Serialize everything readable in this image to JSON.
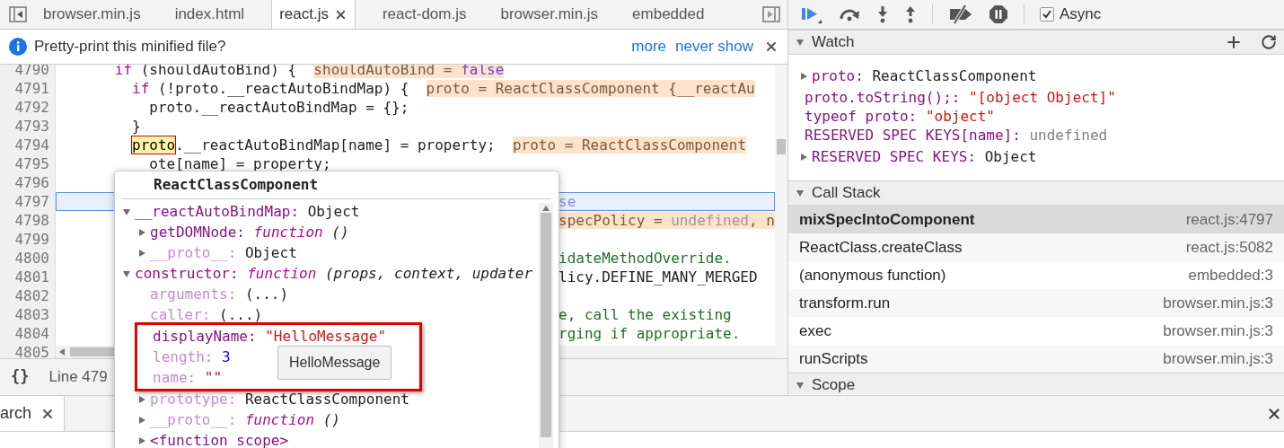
{
  "editor_tabs": [
    {
      "label": "browser.min.js",
      "selected": false,
      "closable": false
    },
    {
      "label": "index.html",
      "selected": false,
      "closable": false
    },
    {
      "label": "react.js",
      "selected": true,
      "closable": true
    },
    {
      "label": "react-dom.js",
      "selected": false,
      "closable": false
    },
    {
      "label": "browser.min.js",
      "selected": false,
      "closable": false
    },
    {
      "label": "embedded",
      "selected": false,
      "closable": false
    }
  ],
  "infobar": {
    "message": "Pretty-print this minified file?",
    "links": [
      "more",
      "never show"
    ]
  },
  "code_lines": [
    {
      "number": "4790",
      "current": false,
      "tokens": [
        {
          "kind": "kw",
          "t": "      if"
        },
        {
          "kind": "plain",
          "t": " (shouldAutoBind) {  "
        },
        {
          "kind": "anno",
          "t": "shouldAutoBind = "
        },
        {
          "kind": "anno-kw",
          "t": "false"
        }
      ]
    },
    {
      "number": "4791",
      "current": false,
      "tokens": [
        {
          "kind": "kw",
          "t": "        if"
        },
        {
          "kind": "plain",
          "t": " (!proto.__reactAutoBindMap) {  "
        },
        {
          "kind": "anno",
          "t": "proto = ReactClassComponent {__reactAu"
        }
      ]
    },
    {
      "number": "4792",
      "current": false,
      "tokens": [
        {
          "kind": "plain",
          "t": "          proto.__reactAutoBindMap = {};"
        }
      ]
    },
    {
      "number": "4793",
      "current": false,
      "tokens": [
        {
          "kind": "plain",
          "t": "        }"
        }
      ]
    },
    {
      "number": "4794",
      "current": false,
      "tokens": [
        {
          "kind": "hl",
          "t": "        proto"
        },
        {
          "kind": "plain",
          "t": ".__reactAutoBindMap[name] = property;  "
        },
        {
          "kind": "anno",
          "t": "proto = ReactClassComponent"
        }
      ]
    },
    {
      "number": "4795",
      "current": false,
      "tokens": [
        {
          "kind": "plain",
          "t": "          ote[name] = property;"
        }
      ]
    },
    {
      "number": "4796",
      "current": false
    },
    {
      "number": "4797",
      "current": true,
      "tail": [
        {
          "kind": "kw-faint",
          "t": "se"
        }
      ]
    },
    {
      "number": "4798",
      "current": false,
      "tail": [
        {
          "kind": "anno",
          "t": "specPolicy = "
        },
        {
          "kind": "anno-dim",
          "t": "undefined"
        },
        {
          "kind": "anno",
          "t": ", n"
        }
      ]
    },
    {
      "number": "4799",
      "current": false
    },
    {
      "number": "4800",
      "current": false,
      "tail": [
        {
          "kind": "comment",
          "t": "idateMethodOverride."
        }
      ]
    },
    {
      "number": "4801",
      "current": false,
      "tail": [
        {
          "kind": "plain",
          "t": "licy.DEFINE_MANY_MERGED"
        }
      ]
    },
    {
      "number": "4802",
      "current": false
    },
    {
      "number": "4803",
      "current": false,
      "tail": [
        {
          "kind": "comment",
          "t": "e, call the existing"
        }
      ]
    },
    {
      "number": "4804",
      "current": false,
      "tail": [
        {
          "kind": "comment",
          "t": "rging if appropriate."
        }
      ]
    },
    {
      "number": "4805",
      "current": false
    }
  ],
  "status_bar": {
    "format_button": "{}",
    "position": "Line 479"
  },
  "drawer": {
    "tab": "arch"
  },
  "debugger_toolbar": {
    "async": {
      "label": "Async",
      "checked": true
    }
  },
  "watch": {
    "title": "Watch",
    "expanded": true,
    "items": [
      {
        "key": "proto:",
        "value": "ReactClassComponent",
        "kind": "object",
        "expandable": true,
        "expanded": false
      },
      {
        "key": "proto.toString();:",
        "value": "\"[object Object]\"",
        "kind": "string",
        "expandable": false
      },
      {
        "key": "typeof proto:",
        "value": "\"object\"",
        "kind": "string",
        "expandable": false
      },
      {
        "key": "RESERVED SPEC KEYS[name]:",
        "value": "undefined",
        "kind": "undefined",
        "expandable": false
      },
      {
        "key": "RESERVED SPEC KEYS:",
        "value": "Object",
        "kind": "object",
        "expandable": true,
        "expanded": false
      }
    ]
  },
  "call_stack": {
    "title": "Call Stack",
    "expanded": true,
    "frames": [
      {
        "function": "mixSpecIntoComponent",
        "location": "react.js:4797",
        "selected": true
      },
      {
        "function": "ReactClass.createClass",
        "location": "react.js:5082",
        "selected": false
      },
      {
        "function": "(anonymous function)",
        "location": "embedded:3",
        "selected": false
      },
      {
        "function": "transform.run",
        "location": "browser.min.js:3",
        "selected": false
      },
      {
        "function": "exec",
        "location": "browser.min.js:3",
        "selected": false
      },
      {
        "function": "runScripts",
        "location": "browser.min.js:3",
        "selected": false
      }
    ]
  },
  "scope": {
    "title": "Scope",
    "expanded": true
  },
  "popover": {
    "title": "ReactClassComponent",
    "tooltip": "HelloMessage",
    "tree": [
      {
        "key": "__reactAutoBindMap:",
        "value": "Object",
        "kind": "object",
        "dim": false,
        "expanded": true,
        "children": [
          {
            "key": "getDOMNode:",
            "type_word": "function",
            "value": "()",
            "kind": "function",
            "dim": false,
            "expanded": false
          },
          {
            "key": "__proto__:",
            "value": "Object",
            "kind": "object",
            "dim": true,
            "expanded": false
          }
        ]
      },
      {
        "key": "constructor:",
        "type_word": "function",
        "value": "(props, context, updater",
        "kind": "function",
        "dim": false,
        "expanded": true,
        "children": [
          {
            "key": "arguments:",
            "value": "(...)",
            "kind": "getter",
            "dim": true
          },
          {
            "key": "caller:",
            "value": "(...)",
            "kind": "getter",
            "dim": true
          },
          {
            "key": "displayName:",
            "value": "\"HelloMessage\"",
            "kind": "string",
            "dim": false,
            "outlined": true
          },
          {
            "key": "length:",
            "value": "3",
            "kind": "number",
            "dim": true,
            "outlined": true
          },
          {
            "key": "name:",
            "value": "\"\"",
            "kind": "string",
            "dim": true,
            "outlined": true
          },
          {
            "key": "prototype:",
            "value": "ReactClassComponent",
            "kind": "object",
            "dim": true,
            "expanded": false
          },
          {
            "key": "__proto__:",
            "type_word": "function",
            "value": "()",
            "kind": "function",
            "dim": true,
            "expanded": false
          },
          {
            "key": "<function scope>",
            "kind": "scope",
            "dim": false,
            "expanded": false
          }
        ]
      }
    ]
  }
}
